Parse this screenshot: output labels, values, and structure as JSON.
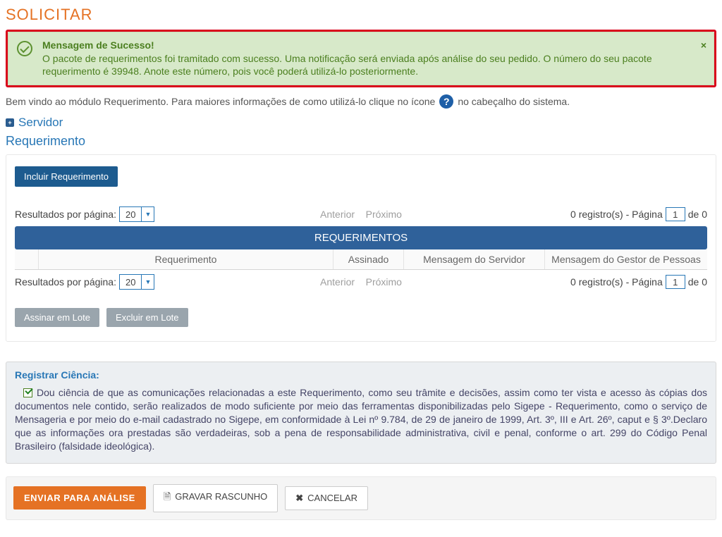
{
  "page_title": "SOLICITAR",
  "alert": {
    "title": "Mensagem de Sucesso!",
    "body": "O pacote de requerimentos foi tramitado com sucesso. Uma notificação será enviada após análise do seu pedido. O número do seu pacote requerimento é 39948. Anote este número, pois você poderá utilizá-lo posteriormente.",
    "close": "×"
  },
  "intro": {
    "before": "Bem vindo ao módulo Requerimento. Para maiores informações de como utilizá-lo clique no ícone",
    "help_glyph": "?",
    "after": "no cabeçalho do sistema."
  },
  "servidor": {
    "label": "Servidor",
    "plus": "+"
  },
  "requerimento": {
    "section_label": "Requerimento",
    "include_btn": "Incluir Requerimento",
    "results_label": "Resultados por página:",
    "results_per_page_value": "20",
    "prev": "Anterior",
    "next": "Próximo",
    "registros_prefix": "0 registro(s) - Página",
    "page_value": "1",
    "de_suffix": "de 0",
    "band_label": "REQUERIMENTOS",
    "columns": {
      "requerimento": "Requerimento",
      "assinado": "Assinado",
      "msg_servidor": "Mensagem do Servidor",
      "msg_gestor": "Mensagem do Gestor de Pessoas"
    },
    "assinar_lote": "Assinar em Lote",
    "excluir_lote": "Excluir em Lote"
  },
  "ciencia": {
    "title": "Registrar Ciência:",
    "checked": true,
    "text": "Dou ciência de que as comunicações relacionadas a este Requerimento, como seu trâmite e decisões, assim como ter vista e acesso às cópias dos documentos nele contido, serão realizados de modo suficiente por meio das ferramentas disponibilizadas pelo Sigepe - Requerimento, como o serviço de Mensageria e por meio do e-mail cadastrado no Sigepe, em conformidade à Lei nº 9.784, de 29 de janeiro de 1999, Art. 3º, III e Art. 26º, caput e § 3º.Declaro que as informações ora prestadas são verdadeiras, sob a pena de responsabilidade administrativa, civil e penal, conforme o art. 299 do Código Penal Brasileiro (falsidade ideológica)."
  },
  "actions": {
    "enviar": "ENVIAR PARA ANÁLISE",
    "gravar": "GRAVAR RASCUNHO",
    "cancelar": "CANCELAR"
  }
}
